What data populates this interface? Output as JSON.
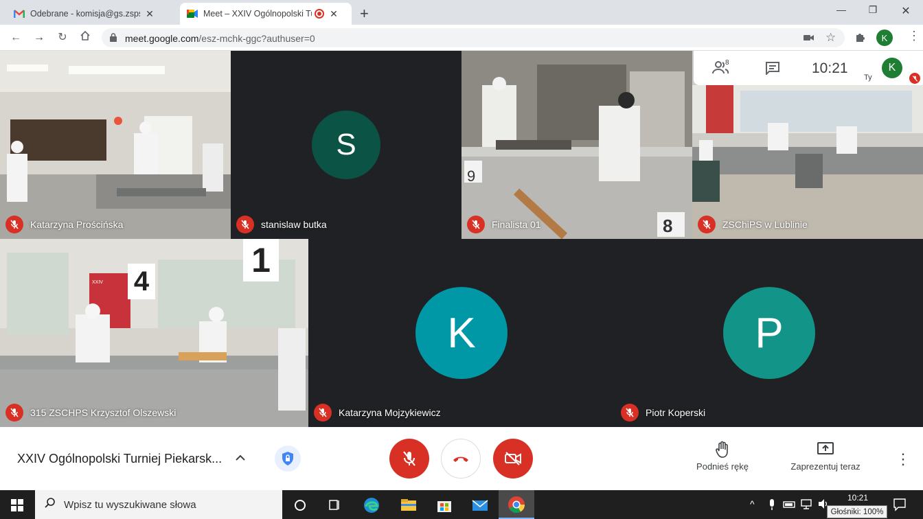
{
  "browser": {
    "tabs": [
      {
        "title": "Odebrane - komisja@gs.zsps.poz",
        "favicon": "gmail-icon"
      },
      {
        "title": "Meet – XXIV Ogólnopolski Tu",
        "favicon": "meet-icon"
      }
    ],
    "new_tab": "+",
    "url_host": "meet.google.com",
    "url_path": "/esz-mchk-ggc?authuser=0",
    "profile_initial": "K"
  },
  "meet": {
    "participants_count": "8",
    "time": "10:21",
    "self_label": "Ty",
    "self_initial": "K",
    "tiles": [
      {
        "name": "Katarzyna Prościńska",
        "type": "video"
      },
      {
        "name": "stanislaw butka",
        "type": "avatar",
        "initial": "S",
        "color": "#0b5344"
      },
      {
        "name": "Finalista 01",
        "type": "video"
      },
      {
        "name": "ZSChiPS w Lublinie",
        "type": "video"
      },
      {
        "name": "315 ZSCHPS Krzysztof Olszewski",
        "type": "video"
      },
      {
        "name": "Katarzyna Mojzykiewicz",
        "type": "avatar",
        "initial": "K",
        "color": "#0097a7"
      },
      {
        "name": "Piotr Koperski",
        "type": "avatar",
        "initial": "P",
        "color": "#129488"
      }
    ],
    "video_labels": {
      "station_9": "9",
      "station_8": "8",
      "station_4": "4",
      "station_1": "1",
      "banner": "XXIV"
    },
    "meeting_title": "XXIV Ogólnopolski Turniej Piekarsk...",
    "raise_hand_label": "Podnieś rękę",
    "present_label": "Zaprezentuj teraz",
    "mic_color": "#d93025"
  },
  "taskbar": {
    "search_placeholder": "Wpisz tu wyszukiwane słowa",
    "clock": "10:21",
    "volume_tooltip": "Głośniki: 100%"
  }
}
